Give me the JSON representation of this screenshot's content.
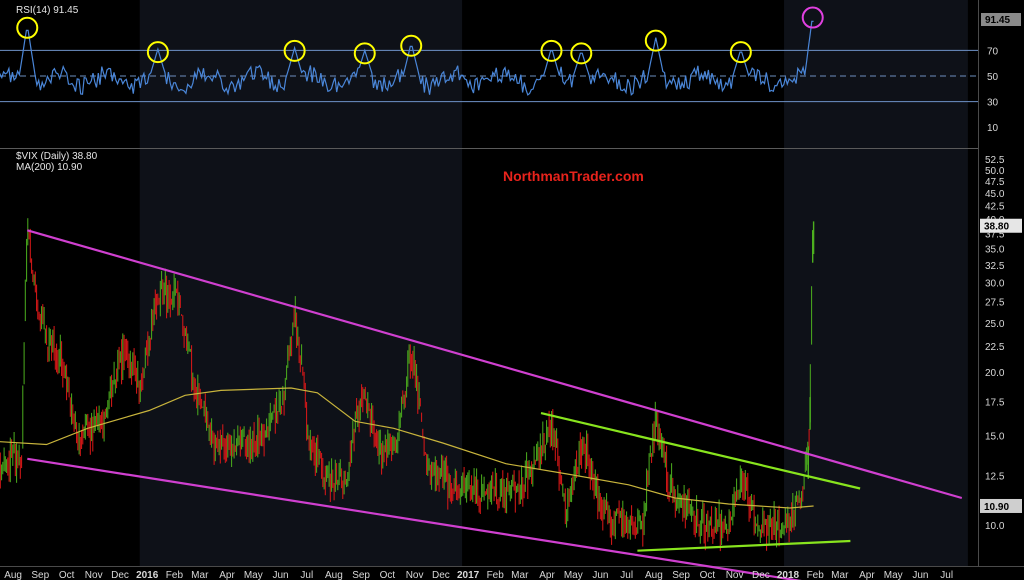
{
  "chart_data": [
    {
      "type": "line",
      "panel": "rsi",
      "legend": "RSI(14) 91.45",
      "last_value_label": "91.45",
      "ylim": [
        0,
        100
      ],
      "yticks": [
        "70",
        "50",
        "30",
        "10"
      ],
      "reference_lines": [
        70,
        50,
        30
      ],
      "series_color": "#4a86d8",
      "highlights": [
        {
          "date": "2015-08-24",
          "value": 90,
          "color": "#ffff00"
        },
        {
          "date": "2016-01-20",
          "value": 71,
          "color": "#ffff00"
        },
        {
          "date": "2016-06-24",
          "value": 72,
          "color": "#ffff00"
        },
        {
          "date": "2016-09-12",
          "value": 70,
          "color": "#ffff00"
        },
        {
          "date": "2016-11-04",
          "value": 76,
          "color": "#ffff00"
        },
        {
          "date": "2017-04-13",
          "value": 72,
          "color": "#ffff00"
        },
        {
          "date": "2017-05-17",
          "value": 70,
          "color": "#ffff00"
        },
        {
          "date": "2017-08-10",
          "value": 80,
          "color": "#ffff00"
        },
        {
          "date": "2017-11-15",
          "value": 71,
          "color": "#ffff00"
        },
        {
          "date": "2018-02-05",
          "value": 98,
          "color": "#e040e0"
        }
      ]
    },
    {
      "type": "candlestick",
      "panel": "vix",
      "legend": "$VIX (Daily) 38.80",
      "ma_legend": "MA(200) 10.90",
      "watermark": "NorthmanTrader.com",
      "last_price_label": "38.80",
      "ma_last_label": "10.90",
      "ylim": [
        7.5,
        54
      ],
      "yticks": [
        "52.5",
        "50.0",
        "47.5",
        "45.0",
        "42.5",
        "40.0",
        "37.5",
        "35.0",
        "32.5",
        "30.0",
        "27.5",
        "25.0",
        "22.5",
        "20.0",
        "17.5",
        "15.0",
        "12.5",
        "10.0"
      ],
      "log_scale": true,
      "x_labels": [
        "Aug",
        "Sep",
        "Oct",
        "Nov",
        "Dec",
        "2016",
        "Feb",
        "Mar",
        "Apr",
        "May",
        "Jun",
        "Jul",
        "Aug",
        "Sep",
        "Oct",
        "Nov",
        "Dec",
        "2017",
        "Feb",
        "Mar",
        "Apr",
        "May",
        "Jun",
        "Jul",
        "Aug",
        "Sep",
        "Oct",
        "Nov",
        "Dec",
        "2018",
        "Feb",
        "Mar",
        "Apr",
        "May",
        "Jun",
        "Jul"
      ],
      "up_color": "#4caf1e",
      "down_color": "#e01818",
      "ma_color": "#c8b43c",
      "price_path": [
        [
          "2015-07-20",
          12.5
        ],
        [
          "2015-08-18",
          13.8
        ],
        [
          "2015-08-24",
          38.0
        ],
        [
          "2015-09-01",
          29.0
        ],
        [
          "2015-09-15",
          23.0
        ],
        [
          "2015-10-01",
          21.0
        ],
        [
          "2015-10-20",
          15.0
        ],
        [
          "2015-11-05",
          15.5
        ],
        [
          "2015-11-20",
          16.0
        ],
        [
          "2015-12-14",
          22.5
        ],
        [
          "2015-12-31",
          18.0
        ],
        [
          "2016-01-20",
          28.0
        ],
        [
          "2016-02-11",
          28.5
        ],
        [
          "2016-03-01",
          19.0
        ],
        [
          "2016-03-20",
          14.5
        ],
        [
          "2016-04-15",
          14.0
        ],
        [
          "2016-05-20",
          15.0
        ],
        [
          "2016-06-10",
          17.0
        ],
        [
          "2016-06-24",
          25.8
        ],
        [
          "2016-07-10",
          14.5
        ],
        [
          "2016-08-01",
          12.5
        ],
        [
          "2016-08-20",
          12.0
        ],
        [
          "2016-09-09",
          18.0
        ],
        [
          "2016-09-30",
          14.0
        ],
        [
          "2016-10-20",
          14.5
        ],
        [
          "2016-11-04",
          22.0
        ],
        [
          "2016-11-20",
          13.0
        ],
        [
          "2016-12-20",
          11.8
        ],
        [
          "2017-01-20",
          11.5
        ],
        [
          "2017-02-20",
          11.5
        ],
        [
          "2017-03-20",
          12.5
        ],
        [
          "2017-04-13",
          15.5
        ],
        [
          "2017-05-01",
          10.5
        ],
        [
          "2017-05-17",
          14.5
        ],
        [
          "2017-06-10",
          10.5
        ],
        [
          "2017-07-10",
          10.0
        ],
        [
          "2017-07-26",
          9.8
        ],
        [
          "2017-08-10",
          16.0
        ],
        [
          "2017-08-25",
          12.0
        ],
        [
          "2017-09-15",
          10.5
        ],
        [
          "2017-10-15",
          9.7
        ],
        [
          "2017-11-01",
          10.0
        ],
        [
          "2017-11-15",
          12.5
        ],
        [
          "2017-12-01",
          10.0
        ],
        [
          "2017-12-20",
          10.0
        ],
        [
          "2018-01-10",
          10.0
        ],
        [
          "2018-01-25",
          12.0
        ],
        [
          "2018-01-31",
          14.0
        ],
        [
          "2018-02-02",
          17.5
        ],
        [
          "2018-02-05",
          37.3
        ],
        [
          "2018-02-06",
          38.8
        ]
      ],
      "ma_path": [
        [
          "2015-07-20",
          14.6
        ],
        [
          "2015-09-15",
          14.4
        ],
        [
          "2015-11-01",
          15.5
        ],
        [
          "2016-01-10",
          16.8
        ],
        [
          "2016-02-20",
          18.0
        ],
        [
          "2016-04-01",
          18.4
        ],
        [
          "2016-06-20",
          18.6
        ],
        [
          "2016-07-20",
          18.2
        ],
        [
          "2016-09-01",
          16.0
        ],
        [
          "2016-10-15",
          15.5
        ],
        [
          "2016-12-10",
          14.5
        ],
        [
          "2017-02-20",
          13.2
        ],
        [
          "2017-05-01",
          12.6
        ],
        [
          "2017-07-10",
          12.0
        ],
        [
          "2017-09-01",
          11.3
        ],
        [
          "2017-11-01",
          11.0
        ],
        [
          "2018-01-10",
          10.8
        ],
        [
          "2018-02-06",
          10.9
        ]
      ],
      "trend_lines": [
        {
          "name": "upper",
          "color": "#d040d0",
          "from": [
            "2015-08-24",
            38.0
          ],
          "to": [
            "2018-07-25",
            11.3
          ]
        },
        {
          "name": "lower",
          "color": "#d040d0",
          "from": [
            "2015-08-24",
            13.5
          ],
          "to": [
            "2018-02-25",
            7.6
          ]
        },
        {
          "name": "channel-top",
          "color": "#88e41e",
          "from": [
            "2017-04-01",
            16.6
          ],
          "to": [
            "2018-03-31",
            11.8
          ]
        },
        {
          "name": "channel-bottom",
          "color": "#88e41e",
          "from": [
            "2017-07-20",
            8.9
          ],
          "to": [
            "2018-03-20",
            9.3
          ]
        }
      ]
    }
  ]
}
